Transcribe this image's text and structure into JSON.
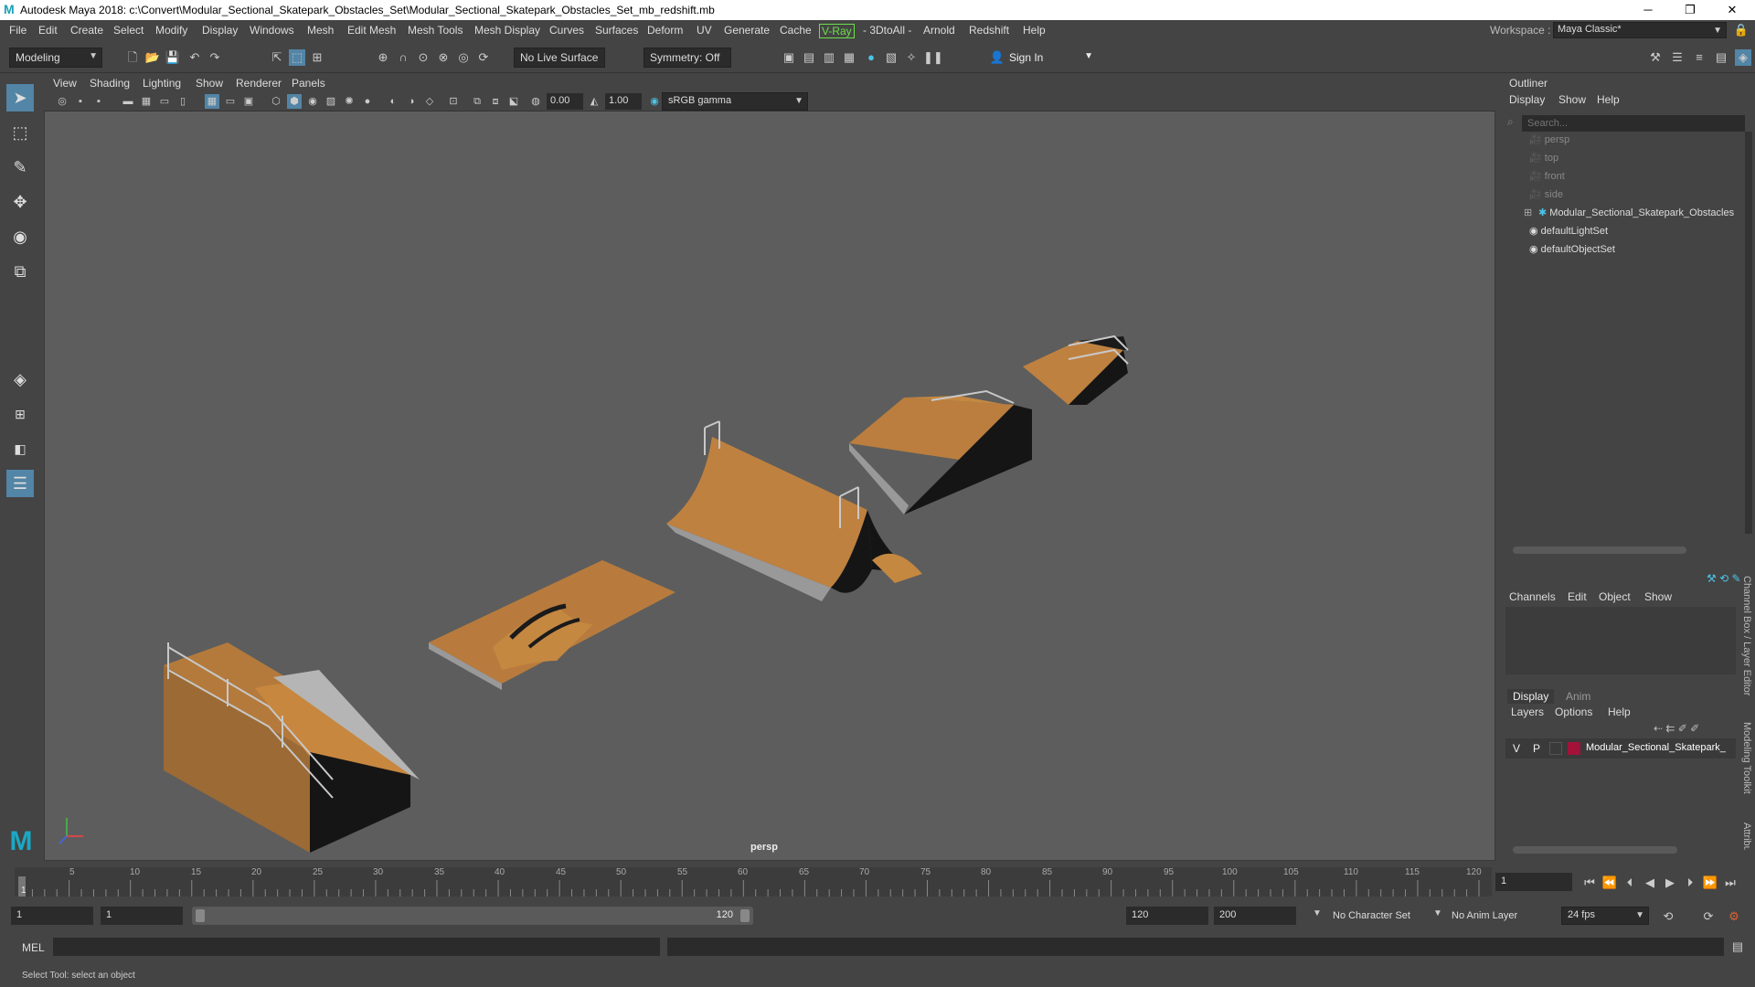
{
  "window": {
    "title": "Autodesk Maya 2018: c:\\Convert\\Modular_Sectional_Skatepark_Obstacles_Set\\Modular_Sectional_Skatepark_Obstacles_Set_mb_redshift.mb",
    "app_icon": "M",
    "minimize": "─",
    "restore": "❐",
    "close": "✕"
  },
  "menubar": {
    "items": [
      "File",
      "Edit",
      "Create",
      "Select",
      "Modify",
      "Display",
      "Windows",
      "Mesh",
      "Edit Mesh",
      "Mesh Tools",
      "Mesh Display",
      "Curves",
      "Surfaces",
      "Deform",
      "UV",
      "Generate",
      "Cache",
      "V-Ray",
      "- 3DtoAll -",
      "Arnold",
      "Redshift",
      "Help"
    ],
    "workspace_label": "Workspace :",
    "workspace_value": "Maya Classic*"
  },
  "shelf": {
    "mode": "Modeling",
    "live_surface": "No Live Surface",
    "symmetry": "Symmetry: Off",
    "sign_in": "Sign In"
  },
  "viewport": {
    "menus": [
      "View",
      "Shading",
      "Lighting",
      "Show",
      "Renderer",
      "Panels"
    ],
    "exposure": "0.00",
    "gamma": "1.00",
    "color_space": "sRGB gamma",
    "camera_label": "persp"
  },
  "outliner": {
    "title": "Outliner",
    "menus": [
      "Display",
      "Show",
      "Help"
    ],
    "search_placeholder": "Search...",
    "items": [
      {
        "label": "persp",
        "icon": "camera-icon",
        "dim": true
      },
      {
        "label": "top",
        "icon": "camera-icon",
        "dim": true
      },
      {
        "label": "front",
        "icon": "camera-icon",
        "dim": true
      },
      {
        "label": "side",
        "icon": "camera-icon",
        "dim": true
      },
      {
        "label": "Modular_Sectional_Skatepark_Obstacles",
        "icon": "group-icon",
        "dim": false
      },
      {
        "label": "defaultLightSet",
        "icon": "set-icon",
        "dim": false
      },
      {
        "label": "defaultObjectSet",
        "icon": "set-icon",
        "dim": false
      }
    ]
  },
  "channel_box": {
    "menus": [
      "Channels",
      "Edit",
      "Object",
      "Show"
    ],
    "tabs": [
      "Display",
      "Anim"
    ],
    "layer_menus": [
      "Layers",
      "Options",
      "Help"
    ],
    "layer": {
      "v": "V",
      "p": "P",
      "name": "Modular_Sectional_Skatepark_",
      "color": "#a3123a"
    },
    "side_tabs": [
      "Channel Box / Layer Editor",
      "Modeling Toolkit",
      "Attribute Editor"
    ]
  },
  "timeline": {
    "ticks": [
      "1",
      "5",
      "10",
      "15",
      "20",
      "25",
      "30",
      "35",
      "40",
      "45",
      "50",
      "55",
      "60",
      "65",
      "70",
      "75",
      "80",
      "85",
      "90",
      "95",
      "100",
      "105",
      "110",
      "115",
      "120"
    ],
    "current_frame": "1"
  },
  "range": {
    "start": "1",
    "playback_start": "1",
    "slider_start": "1",
    "slider_end": "120",
    "playback_end": "120",
    "end": "200",
    "character_set": "No Character Set",
    "anim_layer": "No Anim Layer",
    "fps": "24 fps"
  },
  "command": {
    "label": "MEL"
  },
  "help_line": "Select Tool: select an object"
}
